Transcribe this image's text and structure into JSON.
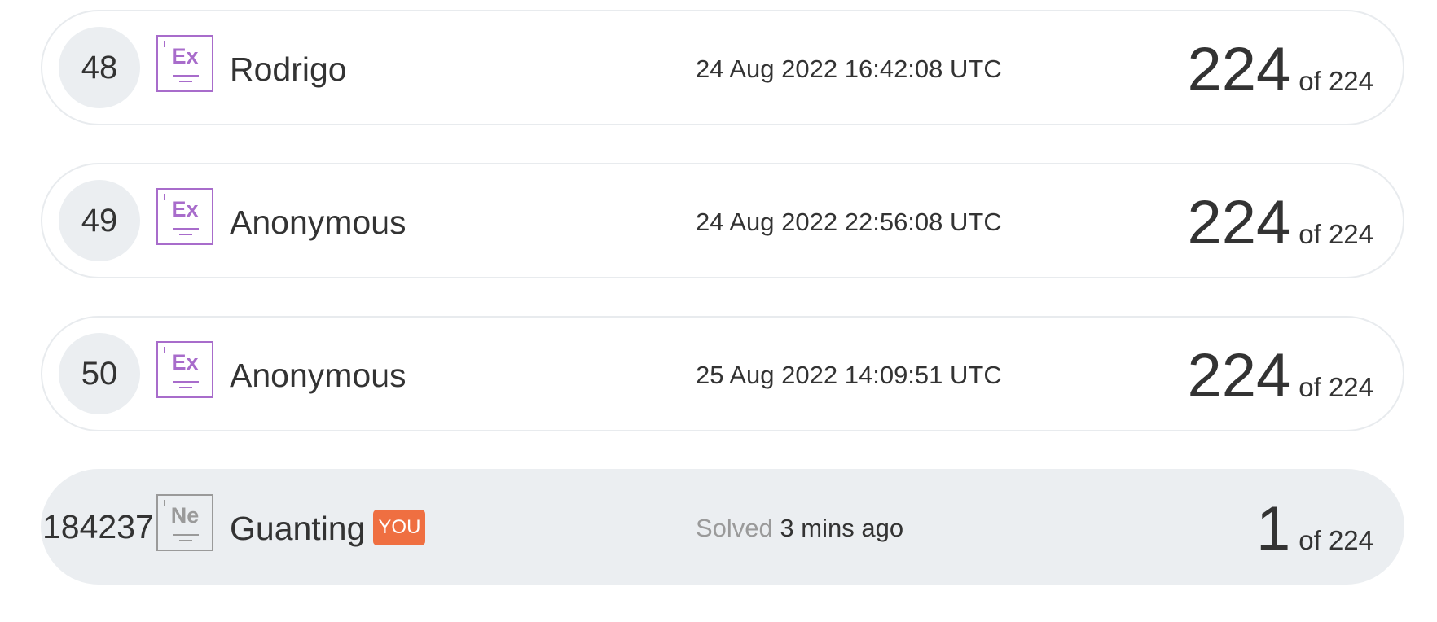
{
  "leaderboard": {
    "rows": [
      {
        "rank": "48",
        "level_code": "Ex",
        "name": "Rodrigo",
        "time": "24 Aug 2022 16:42:08 UTC",
        "score": "224",
        "of_total": "of 224"
      },
      {
        "rank": "49",
        "level_code": "Ex",
        "name": "Anonymous",
        "time": "24 Aug 2022 22:56:08 UTC",
        "score": "224",
        "of_total": "of 224"
      },
      {
        "rank": "50",
        "level_code": "Ex",
        "name": "Anonymous",
        "time": "25 Aug 2022 14:09:51 UTC",
        "score": "224",
        "of_total": "of 224"
      }
    ],
    "current_user": {
      "rank": "184237",
      "level_code": "Ne",
      "name": "Guanting",
      "you_label": "YOU",
      "solved_label": "Solved",
      "solved_ago": "3 mins ago",
      "score": "1",
      "of_total": "of 224"
    }
  },
  "colors": {
    "expert_level": "#a86ccb",
    "novice_level": "#9a9a9a",
    "you_badge": "#ef6f41",
    "row_highlight": "#ebeef1"
  },
  "icons": {
    "expert_level": "level-badge-icon",
    "novice_level": "level-badge-icon"
  }
}
